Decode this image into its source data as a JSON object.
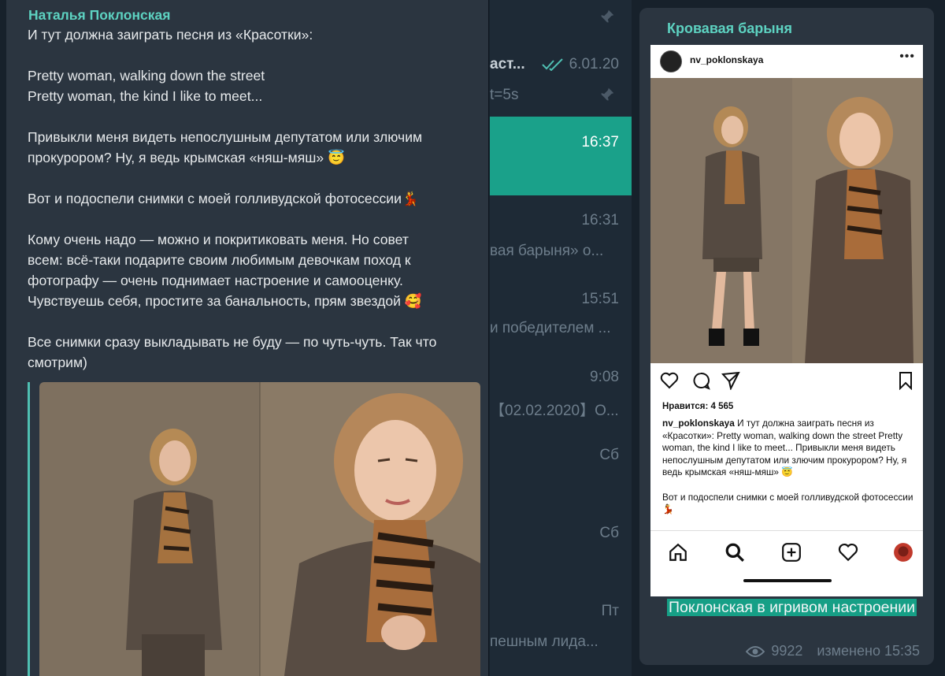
{
  "chat_list": {
    "items": [
      {
        "time": "",
        "text": "",
        "pinned": true
      },
      {
        "time": "6.01.20",
        "text": "аст...",
        "pinned": false
      },
      {
        "time": "",
        "text": "t=5s",
        "pinned": true
      },
      {
        "time": "16:37",
        "text": "",
        "pinned": false
      },
      {
        "time": "16:31",
        "text": "вая барыня» о..."
      },
      {
        "time": "15:51",
        "text": "и победителем ..."
      },
      {
        "time": "9:08",
        "text": "【02.02.2020】О..."
      },
      {
        "time": "Сб",
        "text": ""
      },
      {
        "time": "Сб",
        "text": ""
      },
      {
        "time": "Пт",
        "text": "пешным лида..."
      }
    ]
  },
  "message": {
    "sender": "Наталья Поклонская",
    "text": "И тут должна заиграть песня из «Красотки»:\n\nPretty woman, walking down the street\nPretty woman, the kind I like to meet...\n\nПривыкли меня видеть непослушным депутатом или злючим\nпрокурором? Ну, я ведь крымская «няш-мяш» 😇\n\nВот и подоспели снимки с моей голливудской фотосессии💃\n\nКому очень надо — можно и покритиковать меня. Но совет\nвсем: всё-таки подарите своим любимым девочкам поход к\nфотографу — очень поднимает настроение и самооценку.\nЧувствуешь себя, простите за банальность, прям звездой 🥰\n\nВсе снимки сразу выкладывать не буду — по чуть-чуть. Так что\nсмотрим)"
  },
  "post": {
    "channel": "Кровавая барыня",
    "instagram": {
      "username": "nv_poklonskaya",
      "likes": "Нравится: 4 565",
      "caption_user": "nv_poklonskaya",
      "caption": " И тут должна заиграть песня из «Красотки»: Pretty woman, walking down the street Pretty woman, the kind I like to meet... Привыкли меня видеть непослушным депутатом или злючим прокурором? Ну, я ведь крымская «няш-мяш» 😇\n\nВот и подоспели снимки с моей голливудской фотосессии💃"
    },
    "text": "Поклонская в игривом настроении",
    "views": "9922",
    "edited": "изменено 15:35"
  },
  "colors": {
    "accent": "#5dd2c1",
    "highlight": "#169f86",
    "bubble": "#2b3540",
    "background": "#17212b"
  }
}
